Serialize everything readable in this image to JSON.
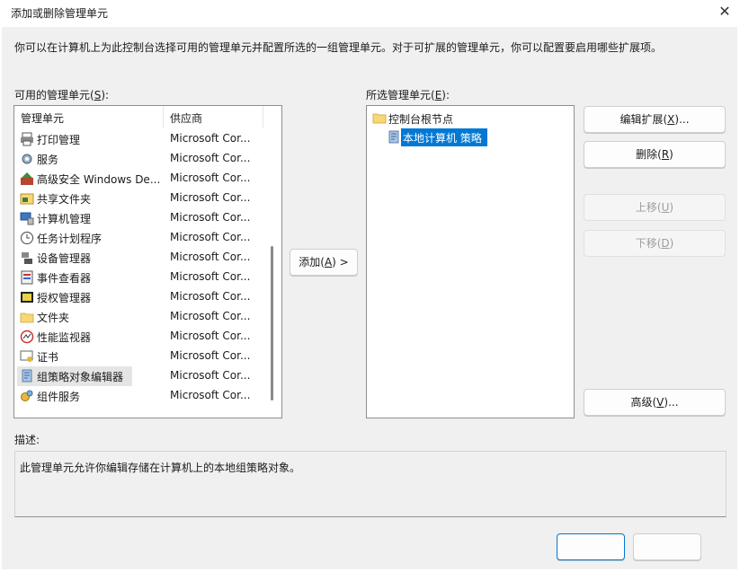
{
  "window": {
    "title": "添加或删除管理单元",
    "close_icon": "close-icon"
  },
  "intro": "你可以在计算机上为此控制台选择可用的管理单元并配置所选的一组管理单元。对于可扩展的管理单元，你可以配置要启用哪些扩展项。",
  "available": {
    "label": "可用的管理单元(",
    "label_key": "S",
    "label_end": "):",
    "col_name": "管理单元",
    "col_vendor": "供应商",
    "items": [
      {
        "name": "打印管理",
        "vendor": "Microsoft Cor...",
        "icon": "printer-icon"
      },
      {
        "name": "服务",
        "vendor": "Microsoft Cor...",
        "icon": "services-gear-icon"
      },
      {
        "name": "高级安全 Windows De...",
        "vendor": "Microsoft Cor...",
        "icon": "firewall-icon"
      },
      {
        "name": "共享文件夹",
        "vendor": "Microsoft Cor...",
        "icon": "shared-folder-icon"
      },
      {
        "name": "计算机管理",
        "vendor": "Microsoft Cor...",
        "icon": "computer-management-icon"
      },
      {
        "name": "任务计划程序",
        "vendor": "Microsoft Cor...",
        "icon": "clock-icon"
      },
      {
        "name": "设备管理器",
        "vendor": "Microsoft Cor...",
        "icon": "device-manager-icon"
      },
      {
        "name": "事件查看器",
        "vendor": "Microsoft Cor...",
        "icon": "event-viewer-icon"
      },
      {
        "name": "授权管理器",
        "vendor": "Microsoft Cor...",
        "icon": "authorization-icon"
      },
      {
        "name": "文件夹",
        "vendor": "Microsoft Cor...",
        "icon": "folder-icon"
      },
      {
        "name": "性能监视器",
        "vendor": "Microsoft Cor...",
        "icon": "performance-monitor-icon"
      },
      {
        "name": "证书",
        "vendor": "Microsoft Cor...",
        "icon": "certificate-icon"
      },
      {
        "name": "组策略对象编辑器",
        "vendor": "Microsoft Cor...",
        "icon": "group-policy-icon"
      },
      {
        "name": "组件服务",
        "vendor": "Microsoft Cor...",
        "icon": "component-services-icon"
      }
    ]
  },
  "add_button": {
    "label": "添加(",
    "key": "A",
    "end": ") >"
  },
  "selected": {
    "label": "所选管理单元(",
    "label_key": "E",
    "label_end": "):",
    "root": "控制台根节点",
    "child": "本地计算机 策略"
  },
  "buttons": {
    "edit_ext": {
      "label": "编辑扩展(",
      "key": "X",
      "end": ")..."
    },
    "remove": {
      "label": "删除(",
      "key": "R",
      "end": ")"
    },
    "move_up": {
      "label": "上移(",
      "key": "U",
      "end": ")"
    },
    "move_down": {
      "label": "下移(",
      "key": "D",
      "end": ")"
    },
    "advanced": {
      "label": "高级(",
      "key": "V",
      "end": ")..."
    }
  },
  "description": {
    "label": "描述:",
    "text": "此管理单元允许你编辑存储在计算机上的本地组策略对象。"
  },
  "colors": {
    "accent": "#0078d4",
    "selection": "#0078d4"
  }
}
